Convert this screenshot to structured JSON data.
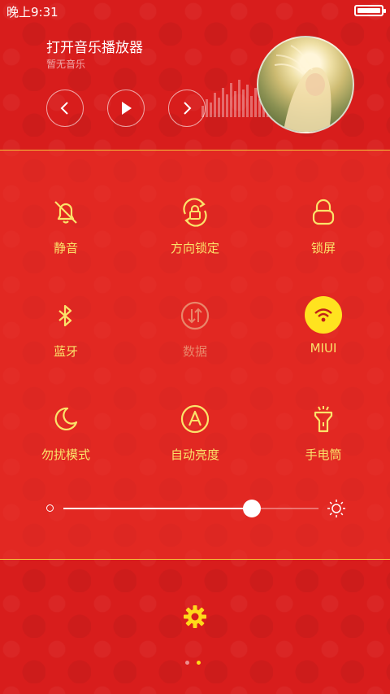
{
  "status_bar": {
    "time": "晚上9:31"
  },
  "music": {
    "title": "打开音乐播放器",
    "subtitle": "暂无音乐",
    "buttons": {
      "prev": "chevron-left-icon",
      "play": "play-icon",
      "next": "chevron-right-icon"
    },
    "album_art": "album-cover"
  },
  "toggles": [
    {
      "label": "静音",
      "icon": "bell-off-icon",
      "state": "off"
    },
    {
      "label": "方向锁定",
      "icon": "rotation-lock-icon",
      "state": "off"
    },
    {
      "label": "锁屏",
      "icon": "lock-icon",
      "state": "off"
    },
    {
      "label": "蓝牙",
      "icon": "bluetooth-icon",
      "state": "off"
    },
    {
      "label": "数据",
      "icon": "data-arrows-icon",
      "state": "disabled"
    },
    {
      "label": "MIUI",
      "icon": "wifi-icon",
      "state": "on"
    },
    {
      "label": "勿扰模式",
      "icon": "moon-icon",
      "state": "off"
    },
    {
      "label": "自动亮度",
      "icon": "auto-brightness-icon",
      "state": "off"
    },
    {
      "label": "手电筒",
      "icon": "flashlight-icon",
      "state": "off"
    }
  ],
  "brightness": {
    "value_percent": 74
  },
  "settings": {
    "icon": "gear-icon"
  },
  "pager": {
    "pages": 2,
    "current": 2
  },
  "colors": {
    "background": "#d81d1c",
    "accent": "#fbe36a",
    "active": "#ffe31f"
  }
}
